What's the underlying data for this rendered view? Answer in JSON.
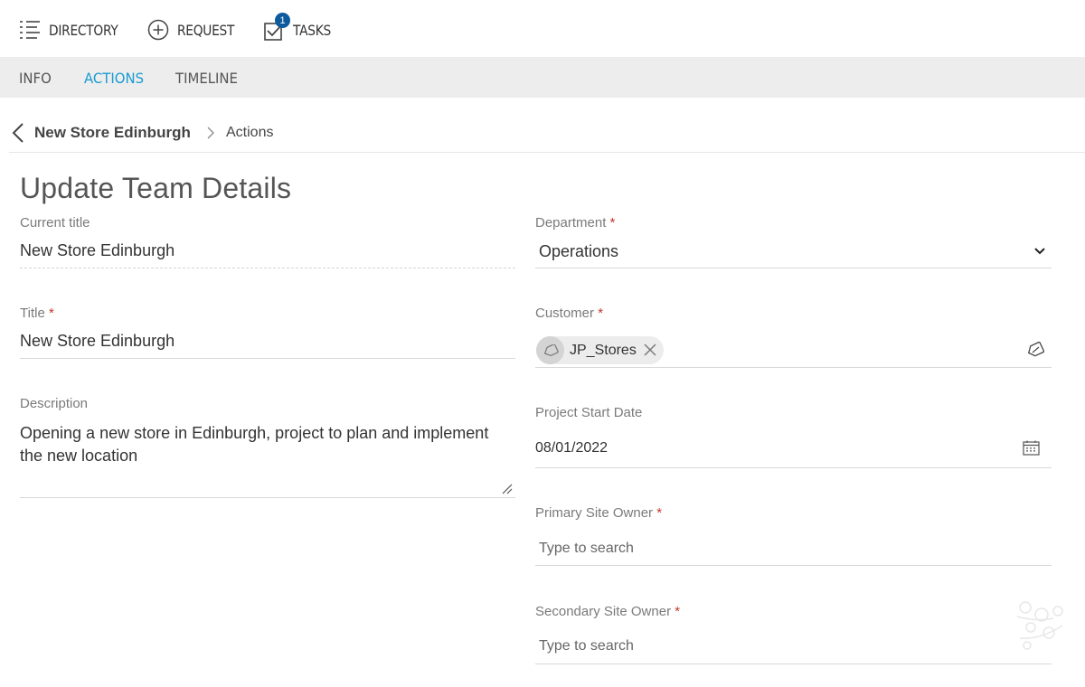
{
  "nav": {
    "directory": "DIRECTORY",
    "request": "REQUEST",
    "tasks": "TASKS",
    "tasks_badge": "1"
  },
  "tabs": [
    "INFO",
    "ACTIONS",
    "TIMELINE"
  ],
  "active_tab": "ACTIONS",
  "breadcrumb": {
    "parent": "New Store Edinburgh",
    "current": "Actions"
  },
  "form": {
    "title": "Update Team Details",
    "current_title": {
      "label": "Current title",
      "value": "New Store Edinburgh"
    },
    "title_field": {
      "label": "Title",
      "required": "*",
      "value": "New Store Edinburgh"
    },
    "description": {
      "label": "Description",
      "value": "Opening a new store in Edinburgh, project to plan and implement the new location"
    },
    "department": {
      "label": "Department",
      "required": "*",
      "value": "Operations"
    },
    "customer": {
      "label": "Customer",
      "required": "*",
      "chip": "JP_Stores"
    },
    "start_date": {
      "label": "Project Start Date",
      "value": "08/01/2022"
    },
    "primary_owner": {
      "label": "Primary Site Owner",
      "required": "*",
      "placeholder": "Type to search"
    },
    "secondary_owner": {
      "label": "Secondary Site Owner",
      "required": "*",
      "placeholder": "Type to search"
    }
  },
  "colors": {
    "accent": "#1a9bd0",
    "badge": "#0d5a9c",
    "required": "#c0392b",
    "tabbar": "#ededed"
  },
  "icons": {
    "directory": "list-icon",
    "request": "plus-circle-icon",
    "tasks": "checkbox-icon",
    "back": "chevron-left-icon",
    "separator": "chevron-right-icon",
    "dropdown": "chevron-down-icon",
    "tag": "tag-icon",
    "clear": "close-icon",
    "calendar": "calendar-icon"
  }
}
